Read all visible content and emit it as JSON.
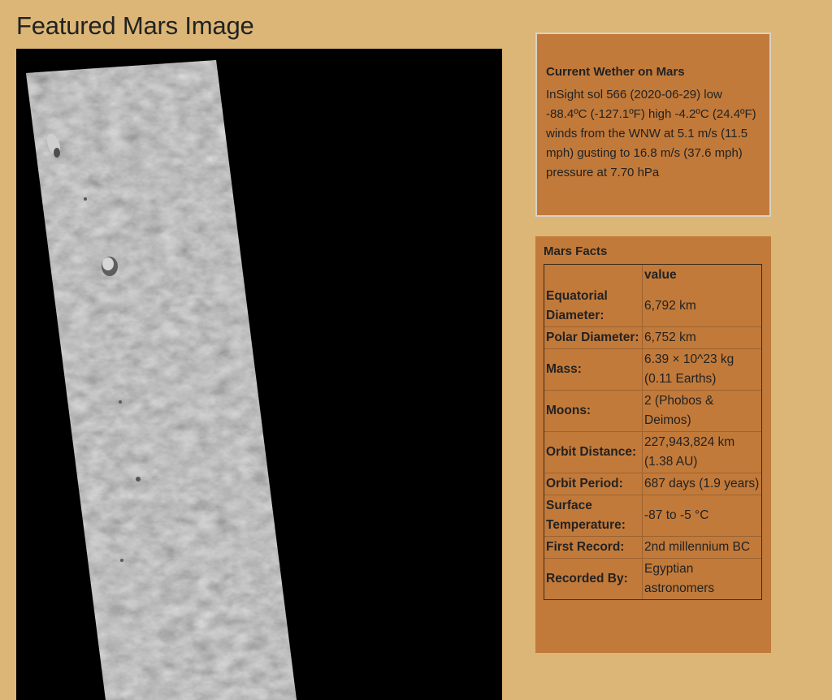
{
  "page": {
    "title": "Featured Mars Image"
  },
  "weather": {
    "title": "Current Wether on Mars",
    "text": "InSight sol 566 (2020-06-29) low -88.4ºC (-127.1ºF) high -4.2ºC (24.4ºF) winds from the WNW at 5.1 m/s (11.5 mph) gusting to 16.8 m/s (37.6 mph) pressure at 7.70 hPa"
  },
  "facts": {
    "title": "Mars Facts",
    "header": {
      "label": "",
      "value": "value"
    },
    "rows": [
      {
        "label": "Equatorial Diameter:",
        "value": "6,792 km"
      },
      {
        "label": "Polar Diameter:",
        "value": "6,752 km"
      },
      {
        "label": "Mass:",
        "value": "6.39 × 10^23 kg (0.11 Earths)"
      },
      {
        "label": "Moons:",
        "value": "2 (Phobos & Deimos)"
      },
      {
        "label": "Orbit Distance:",
        "value": "227,943,824 km (1.38 AU)"
      },
      {
        "label": "Orbit Period:",
        "value": "687 days (1.9 years)"
      },
      {
        "label": "Surface Temperature:",
        "value": "-87 to -5 °C"
      },
      {
        "label": "First Record:",
        "value": "2nd millennium BC"
      },
      {
        "label": "Recorded By:",
        "value": "Egyptian astronomers"
      }
    ]
  },
  "colors": {
    "page_background": "#dcb676",
    "panel_background": "#c27a3a",
    "image_background": "#000000"
  }
}
